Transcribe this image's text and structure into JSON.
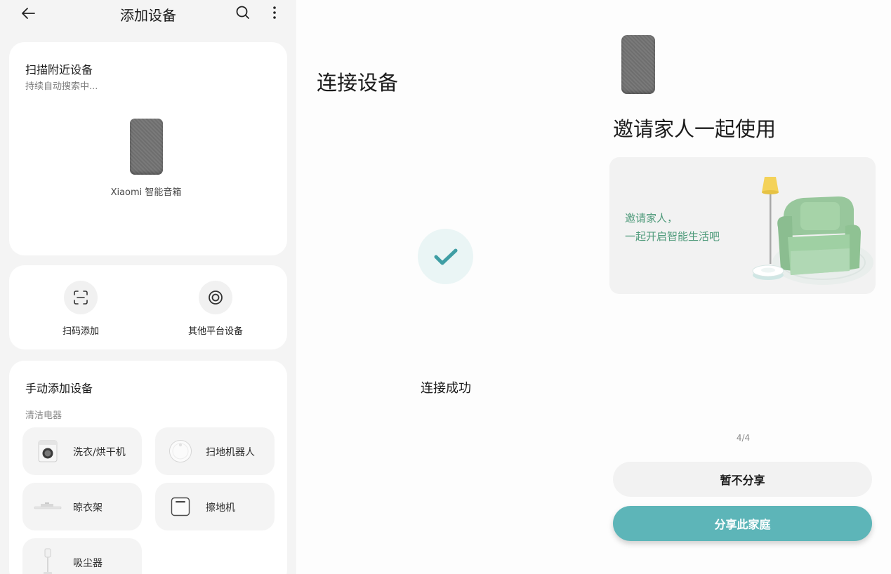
{
  "left": {
    "topbar": {
      "title": "添加设备",
      "back_icon": "arrow-left-icon",
      "search_icon": "search-icon",
      "more_icon": "more-vertical-icon"
    },
    "scan": {
      "title": "扫描附近设备",
      "subtitle": "持续自动搜索中...",
      "device_name": "Xiaomi 智能音箱"
    },
    "actions": [
      {
        "label": "扫码添加",
        "icon": "scan-code-icon"
      },
      {
        "label": "其他平台设备",
        "icon": "platform-ring-icon"
      }
    ],
    "manual": {
      "title": "手动添加设备",
      "category": "清洁电器",
      "items": [
        {
          "label": "洗衣/烘干机",
          "icon": "washer-icon"
        },
        {
          "label": "扫地机器人",
          "icon": "robot-vacuum-icon"
        },
        {
          "label": "晾衣架",
          "icon": "clothes-rack-icon"
        },
        {
          "label": "擦地机",
          "icon": "floor-scrubber-icon"
        },
        {
          "label": "吸尘器",
          "icon": "vacuum-cleaner-icon"
        }
      ]
    }
  },
  "middle": {
    "title": "连接设备",
    "status": "连接成功",
    "status_icon": "checkmark-icon"
  },
  "right": {
    "title": "邀请家人一起使用",
    "card_text_line1": "邀请家人，",
    "card_text_line2": "一起开启智能生活吧",
    "pager": "4/4",
    "skip_button": "暂不分享",
    "share_button": "分享此家庭"
  },
  "colors": {
    "accent": "#5db5b8",
    "invite_text": "#4e9a7a",
    "check": "#3f9ea4"
  }
}
